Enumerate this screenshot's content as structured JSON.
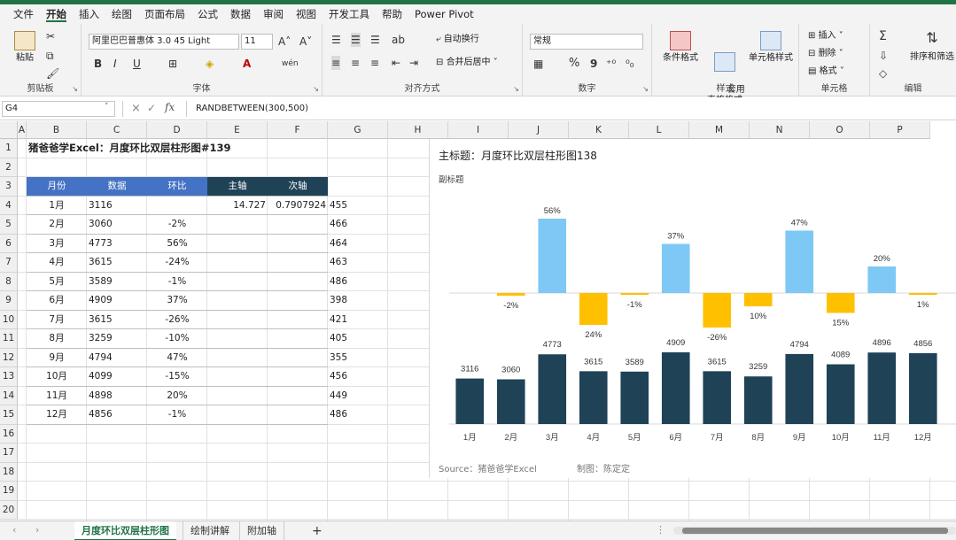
{
  "menu": [
    "文件",
    "开始",
    "插入",
    "绘图",
    "页面布局",
    "公式",
    "数据",
    "审阅",
    "视图",
    "开发工具",
    "帮助",
    "Power Pivot"
  ],
  "ribbon": {
    "clipboard": {
      "paste": "粘贴",
      "label": "剪贴板"
    },
    "font": {
      "name": "阿里巴巴普惠体 3.0 45 Light",
      "size": "11",
      "bold": "B",
      "italic": "I",
      "underline": "U",
      "grow": "A˄",
      "shrink": "A˅",
      "wen": "wén",
      "label": "字体"
    },
    "align": {
      "wrap": "自动换行",
      "merge": "合并后居中",
      "label": "对齐方式"
    },
    "number": {
      "format": "常规",
      "percent": "%",
      "comma": "9",
      "label": "数字"
    },
    "styles": {
      "conditional": "条件格式",
      "table": "套用\n表格格式",
      "cell": "单元格样式",
      "label": "样式"
    },
    "cells": {
      "insert": "插入",
      "delete": "删除",
      "format": "格式",
      "label": "单元格"
    },
    "editing": {
      "sum": "Σ",
      "sort": "排序和筛选",
      "label": "编辑"
    }
  },
  "formula_bar": {
    "name_box": "G4",
    "fx": "fx",
    "formula": "RANDBETWEEN(300,500)"
  },
  "columns": [
    "A",
    "B",
    "C",
    "D",
    "E",
    "F",
    "G",
    "H",
    "I",
    "J",
    "K",
    "L",
    "M",
    "N",
    "O",
    "P"
  ],
  "rows": [
    "1",
    "2",
    "3",
    "4",
    "5",
    "6",
    "7",
    "8",
    "9",
    "10",
    "11",
    "12",
    "13",
    "14",
    "15",
    "16",
    "17",
    "18",
    "19",
    "20"
  ],
  "sheet": {
    "title": "猪爸爸学Excel：月度环比双层柱形图#139",
    "headers": [
      "月份",
      "数据",
      "环比",
      "主轴",
      "次轴"
    ],
    "table_rows": [
      {
        "month": "1月",
        "value": "3116",
        "ratio": "",
        "main": "14.727",
        "sub": "0.7907924",
        "g": "455"
      },
      {
        "month": "2月",
        "value": "3060",
        "ratio": "-2%",
        "main": "",
        "sub": "",
        "g": "466"
      },
      {
        "month": "3月",
        "value": "4773",
        "ratio": "56%",
        "main": "",
        "sub": "",
        "g": "464"
      },
      {
        "month": "4月",
        "value": "3615",
        "ratio": "-24%",
        "main": "",
        "sub": "",
        "g": "463"
      },
      {
        "month": "5月",
        "value": "3589",
        "ratio": "-1%",
        "main": "",
        "sub": "",
        "g": "486"
      },
      {
        "month": "6月",
        "value": "4909",
        "ratio": "37%",
        "main": "",
        "sub": "",
        "g": "398"
      },
      {
        "month": "7月",
        "value": "3615",
        "ratio": "-26%",
        "main": "",
        "sub": "",
        "g": "421"
      },
      {
        "month": "8月",
        "value": "3259",
        "ratio": "-10%",
        "main": "",
        "sub": "",
        "g": "405"
      },
      {
        "month": "9月",
        "value": "4794",
        "ratio": "47%",
        "main": "",
        "sub": "",
        "g": "355"
      },
      {
        "month": "10月",
        "value": "4099",
        "ratio": "-15%",
        "main": "",
        "sub": "",
        "g": "456"
      },
      {
        "month": "11月",
        "value": "4898",
        "ratio": "20%",
        "main": "",
        "sub": "",
        "g": "449"
      },
      {
        "month": "12月",
        "value": "4856",
        "ratio": "-1%",
        "main": "",
        "sub": "",
        "g": "486"
      }
    ]
  },
  "chart_data": {
    "type": "bar",
    "title": "主标题：月度环比双层柱形图138",
    "subtitle": "副标题",
    "categories": [
      "1月",
      "2月",
      "3月",
      "4月",
      "5月",
      "6月",
      "7月",
      "8月",
      "9月",
      "10月",
      "11月",
      "12月"
    ],
    "series": [
      {
        "values": [
          3116,
          3060,
          4773,
          3615,
          3589,
          4909,
          3615,
          3259,
          4794,
          4089,
          4896,
          4856
        ],
        "labels": [
          "3116",
          "3060",
          "4773",
          "3615",
          "3589",
          "4909",
          "3615",
          "3259",
          "4794",
          "4089",
          "4896",
          "4856"
        ]
      },
      {
        "values": [
          0,
          -2,
          56,
          -24,
          -1,
          37,
          -26,
          -10,
          47,
          -15,
          20,
          -1
        ],
        "labels": [
          "",
          "-2%",
          "56%",
          "24%",
          "-1%",
          "37%",
          "-26%",
          "10%",
          "47%",
          "15%",
          "20%",
          "1%"
        ]
      }
    ],
    "colors": {
      "main": "#1f4257",
      "positive": "#7ec8f5",
      "negative": "#ffc000"
    },
    "source": "Source：猪爸爸学Excel",
    "author": "制图：陈定定"
  },
  "tabs": {
    "items": [
      "月度环比双层柱形图",
      "绘制讲解",
      "附加轴"
    ],
    "active": 0,
    "add": "+"
  },
  "colors": {
    "header_blue": "#4472c4",
    "header_dark": "#1f4257",
    "excel_green": "#217346"
  }
}
